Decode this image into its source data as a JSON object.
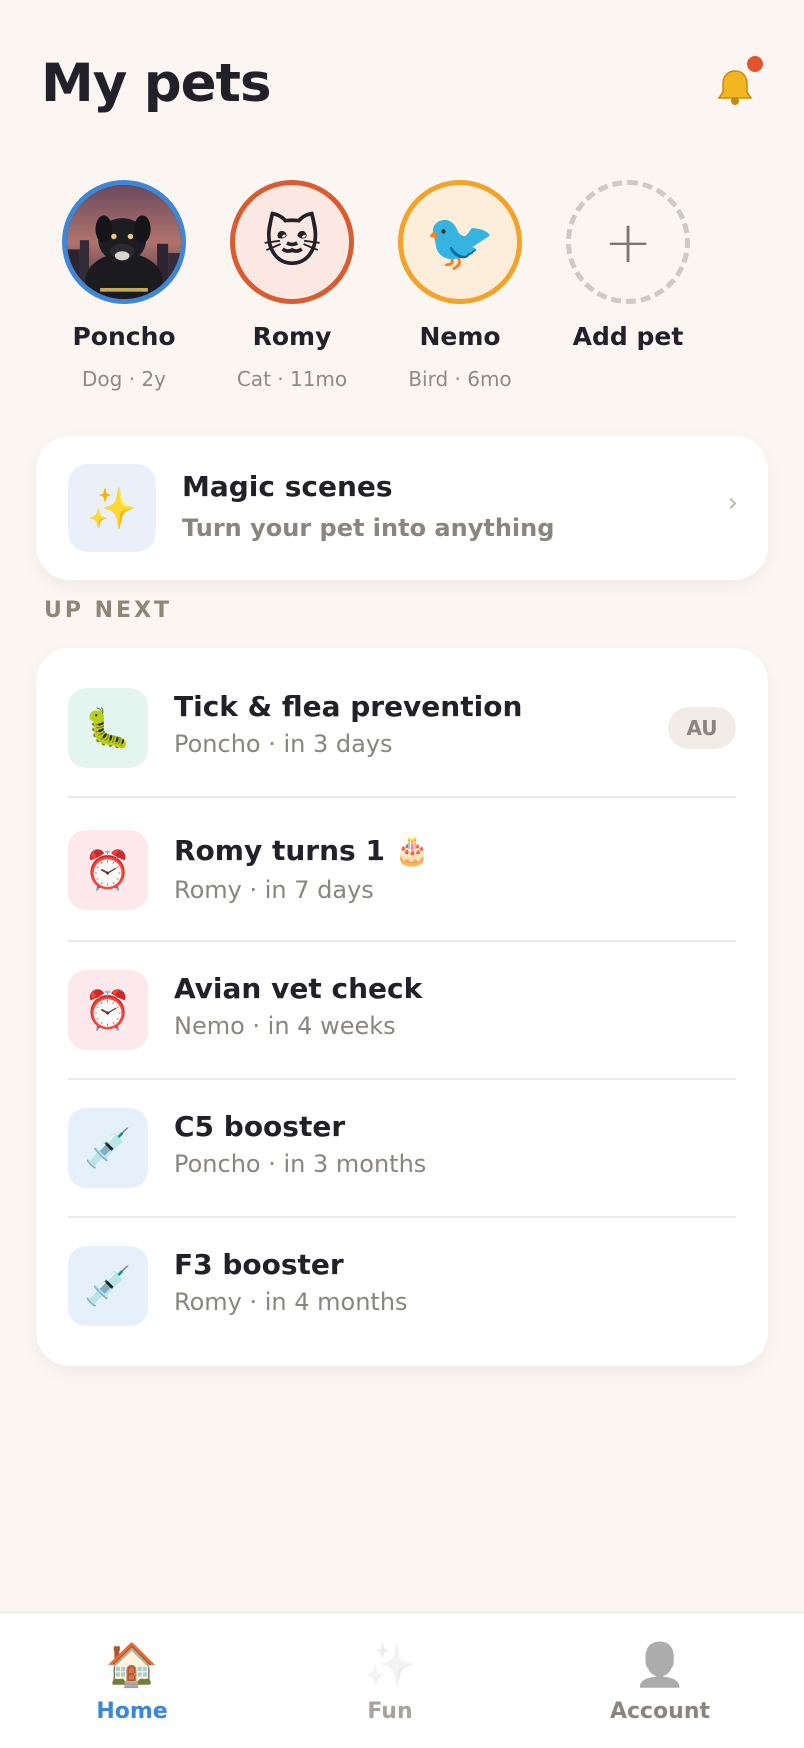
{
  "header": {
    "title": "My pets",
    "notification_icon": "bell-icon",
    "has_unread": true
  },
  "pets": [
    {
      "name": "Poncho",
      "info": "Dog · 2y",
      "ring_color": "#3f86d6",
      "avatar": "photo"
    },
    {
      "name": "Romy",
      "info": "Cat · 11mo",
      "ring_color": "#d85b32",
      "avatar": "🐱"
    },
    {
      "name": "Nemo",
      "info": "Bird · 6mo",
      "ring_color": "#f2a32a",
      "avatar": "🐦"
    },
    {
      "name": "Add pet",
      "icon": "+"
    }
  ],
  "magic": {
    "title": "Magic scenes",
    "subtitle": "Turn your pet into anything",
    "icon": "✨",
    "chevron": "›"
  },
  "up_next": {
    "label": "UP NEXT",
    "items": [
      {
        "icon": "🐛",
        "icon_bg": "#e3f5ee",
        "title": "Tick & flea prevention",
        "subtitle": "Poncho · in 3 days",
        "badge": "AU"
      },
      {
        "icon": "⏰",
        "icon_bg": "#fde9ec",
        "title": "Romy turns 1 🎂",
        "subtitle": "Romy · in 7 days"
      },
      {
        "icon": "⏰",
        "icon_bg": "#fde9ec",
        "title": "Avian vet check",
        "subtitle": "Nemo · in 4 weeks"
      },
      {
        "icon": "💉",
        "icon_bg": "#e6f0fb",
        "title": "C5 booster",
        "subtitle": "Poncho · in 3 months"
      },
      {
        "icon": "💉",
        "icon_bg": "#e6f0fb",
        "title": "F3 booster",
        "subtitle": "Romy · in 4 months"
      }
    ]
  },
  "tabs": [
    {
      "label": "Home",
      "icon": "🏠",
      "active": true
    },
    {
      "label": "Fun",
      "icon": "✨",
      "active": false
    },
    {
      "label": "Account",
      "icon": "👤",
      "active": false
    }
  ],
  "colors": {
    "background": "#fbf6f1",
    "accent": "#3b87d8",
    "notification_dot": "#e2542c"
  }
}
